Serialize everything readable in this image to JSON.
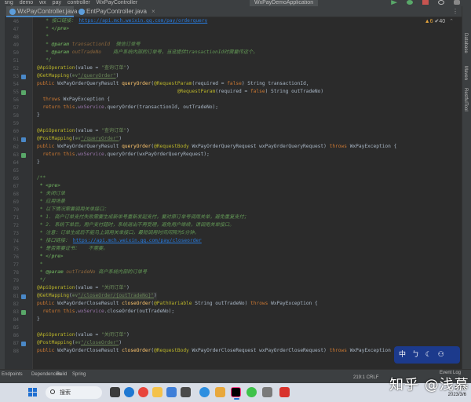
{
  "breadcrumb": [
    "wang",
    "demo",
    "wx",
    "pay",
    "controller",
    "WxPayController"
  ],
  "run_config": "WxPayDemoApplication",
  "tabs": [
    {
      "label": "WxPayController.java",
      "active": true
    },
    {
      "label": "EntPayController.java",
      "active": false
    }
  ],
  "inspection": {
    "warnings": "▲6",
    "weak": "✔40"
  },
  "line_numbers": [
    "46",
    "47",
    "48",
    "49",
    "50",
    "51",
    "52",
    "53",
    "54",
    "55",
    "56",
    "57",
    "58",
    "59",
    "60",
    "61",
    "62",
    "63",
    "64",
    "65",
    "66",
    "67",
    "68",
    "69",
    "70",
    "71",
    "72",
    "73",
    "74",
    "75",
    "76",
    "77",
    "78",
    "79",
    "80",
    "81",
    "82",
    "83",
    "84",
    "85",
    "86",
    "87",
    "88"
  ],
  "code": {
    "l01_doc_url_label": "* 接口链接：",
    "l01_url": "https://api.mch.weixin.qq.com/pay/orderquery",
    "l02_pre_close": "</pre>",
    "l05_param_tag": "@param",
    "l05_param_name": "transactionId",
    "l05_param_desc": "微信订单号",
    "l06_param_tag": "@param",
    "l06_param_name": "outTradeNo",
    "l06_param_desc": "商户系统内部的订单号，当没提供transactionId时需要传这个。",
    "l08_ann": "@ApiOperation",
    "l08_value": "(value = ",
    "l08_str": "\"查询订单\"",
    "l09_ann": "@GetMapping",
    "l09_str": "\"/queryOrder\"",
    "l10_sig_a": "WxPayOrderQueryResult",
    "l10_fn": "queryOrder",
    "l10_ann": "@RequestParam",
    "l10_args": "(required = ",
    "l10_tail": ") String transactionId,",
    "l11_ann": "@RequestParam",
    "l11_tail": ") String outTradeNo)",
    "l12_throws": "throws",
    "l12_exc": "WxPayException {",
    "l13_return": "return",
    "l13_this": "this",
    "l13_field": "wxService",
    "l13_call": ".queryOrder(transactionId, outTradeNo);",
    "l16_str": "\"查询订单\"",
    "l17_ann": "@PostMapping",
    "l17_str": "\"/queryOrder\"",
    "l18_sig": "WxPayOrderQueryResult",
    "l18_fn": "queryOrder",
    "l18_ann": "@RequestBody",
    "l18_args": "WxPayOrderQueryRequest wxPayOrderQueryRequest)",
    "l18_throws": "throws",
    "l18_exc": "WxPayException {",
    "l19_call": ".queryOrder(wxPayOrderQueryRequest);",
    "l22_doc": "/**",
    "l23_pre": "* <pre>",
    "l24": "* 关闭订单",
    "l25": "* 应用场景",
    "l26": "* 以下情况需要调用关单接口：",
    "l27": "* 1. 商户订单支付失败需要生成新单号重新发起支付，要对原订单号调用关单，避免重复支付；",
    "l28": "* 2. 系统下单后，用户支付超时，系统退出不再受理，避免用户继续，请调用关单接口。",
    "l29": "* 注意：订单生成后不能马上调用关单接口，最短调用时间间隔为5分钟。",
    "l30_label": "* 接口链接：",
    "l30_url": "https://api.mch.weixin.qq.com/pay/closeorder",
    "l31": "* 是否需要证书：   不需要。",
    "l32": "* </pre>",
    "l33": "*",
    "l34_tag": "@param",
    "l34_name": "outTradeNo",
    "l34_desc": "商户系统内部的订单号",
    "l35": "*/",
    "l36_str": "\"关闭订单\"",
    "l37_ann": "@GetMapping",
    "l37_str": "\"/closeOrder/{outTradeNo}\"",
    "l38_sig": "WxPayOrderCloseResult",
    "l38_fn": "closeOrder",
    "l38_ann": "@PathVariable",
    "l38_args": "String outTradeNo)",
    "l38_throws": "throws",
    "l38_exc": "WxPayException {",
    "l39_call": ".closeOrder(outTradeNo);",
    "l42_str": "\"关闭订单\"",
    "l43_ann": "@PostMapping",
    "l43_str": "\"/closeOrder\"",
    "l44_sig": "WxPayOrderCloseResult",
    "l44_fn": "closeOrder",
    "l44_ann": "@RequestBody",
    "l44_args": "WxPayOrderCloseRequest wxPayOrderCloseRequest)",
    "l44_throws": "throws",
    "l44_exc": "WxPayException {"
  },
  "common": {
    "public": "public",
    "false": "false",
    "close_brace": "}",
    "doc_star": "*",
    "doc_end": "*/",
    "api_op": "@ApiOperation",
    "value_eq": "(value = ",
    "close_paren": ")",
    "mapping_prefix": "(",
    "mapping_suffix": ")",
    "return": "return",
    "this": "this",
    "wxService": "wxService"
  },
  "ime": {
    "lang": "中",
    "items": [
      "ㄅ",
      "☾",
      "⚇",
      "◐"
    ]
  },
  "bottom_tabs": [
    "Endpoints",
    "Dependencies",
    "Build",
    "Spring"
  ],
  "status": {
    "position": "219:1",
    "encoding": "CRLF",
    "event_log": "Event Log"
  },
  "taskbar": {
    "search_placeholder": "搜索",
    "time": "17:04",
    "date": "2023/3/6"
  },
  "right_panel_labels": [
    "Database",
    "Maven",
    "RestfulTool"
  ],
  "watermark": "知乎 @浅慕",
  "colors": {
    "keyword": "#cc7832",
    "annotation": "#bbb529",
    "string": "#6a8759",
    "comment": "#629755",
    "field": "#9876aa",
    "method": "#ffc66d",
    "accent": "#4a88c7"
  }
}
